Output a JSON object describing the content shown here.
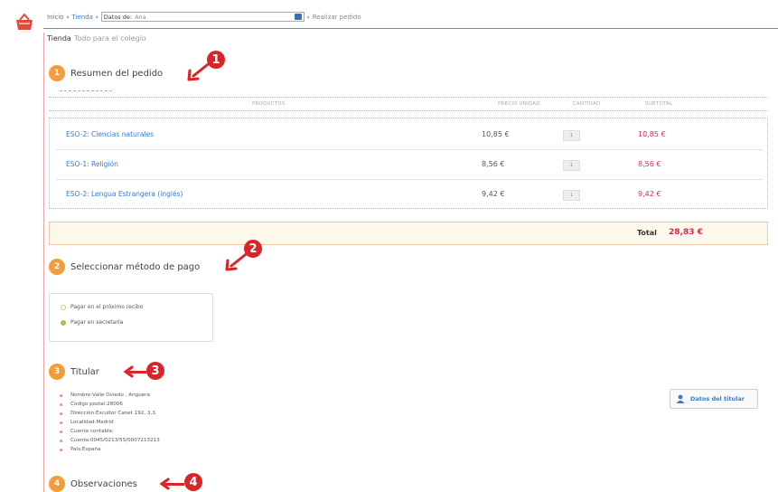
{
  "breadcrumb": {
    "home": "Inicio",
    "store": "Tienda",
    "data_label": "Datos de:",
    "data_value": "Ana",
    "current": "Realizar pedido"
  },
  "store_header": {
    "title": "Tienda",
    "subtitle": "Todo para el colegio"
  },
  "sections": [
    {
      "number": "1",
      "title": "Resumen del pedido",
      "marker": "1"
    },
    {
      "number": "2",
      "title": "Seleccionar método de pago",
      "marker": "2"
    },
    {
      "number": "3",
      "title": "Titular",
      "marker": "3"
    },
    {
      "number": "4",
      "title": "Observaciones",
      "marker": "4"
    }
  ],
  "order_table": {
    "columns": [
      "PRODUCTOS",
      "PRECIO UNIDAD",
      "CANTIDAD",
      "SUBTOTAL"
    ],
    "rows": [
      {
        "product": "ESO-2: Ciencias naturales",
        "price": "10,85 €",
        "qty": "1",
        "subtotal": "10,85 €"
      },
      {
        "product": "ESO-1: Religión",
        "price": "8,56 €",
        "qty": "1",
        "subtotal": "8,56 €"
      },
      {
        "product": "ESO-2: Lengua Estrangera (inglés)",
        "price": "9,42 €",
        "qty": "1",
        "subtotal": "9,42 €"
      }
    ],
    "total_label": "Total",
    "total_value": "28,83 €"
  },
  "payment": {
    "options": [
      {
        "label": "Pagar en el próximo recibo",
        "selected": false
      },
      {
        "label": "Pagar en secretaría",
        "selected": true
      }
    ]
  },
  "holder": {
    "lines": [
      "Nombre:Valle Oviedo , Anguera",
      "Código postal:28006",
      "Dirección:Escultor Canet 192, 3,3.",
      "Localidad:Madrid",
      "Cuenta contable:",
      "Cuenta:0045/0213/55/0007213213",
      "País:España"
    ],
    "button_label": "Datos del titular"
  },
  "colors": {
    "accent_orange": "#f39c3a",
    "price_red": "#e2245a",
    "link_blue": "#3a7bc8",
    "marker_red": "#d9252a"
  }
}
